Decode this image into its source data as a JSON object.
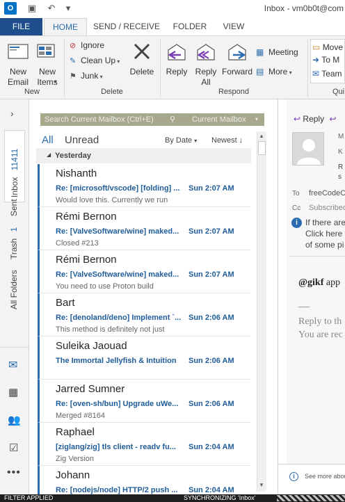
{
  "window": {
    "title": "Inbox - vm0b0t@com"
  },
  "ribbon_tabs": {
    "file": "FILE",
    "home": "HOME",
    "send_receive": "SEND / RECEIVE",
    "folder": "FOLDER",
    "view": "VIEW"
  },
  "ribbon": {
    "new_email": "New\nEmail",
    "new_email_l1": "New",
    "new_email_l2": "Email",
    "new_items_l1": "New",
    "new_items_l2": "Items",
    "group_new": "New",
    "ignore": "Ignore",
    "clean_up": "Clean Up",
    "junk": "Junk",
    "delete": "Delete",
    "group_delete": "Delete",
    "reply": "Reply",
    "reply_all_l1": "Reply",
    "reply_all_l2": "All",
    "forward": "Forward",
    "meeting": "Meeting",
    "more": "More",
    "group_respond": "Respond",
    "move_to": "Move",
    "to_manager": "To M",
    "team": "Team",
    "group_quick": "Qui"
  },
  "leftnav": {
    "inbox_label": "Inbox",
    "inbox_count": "11411",
    "sent_label": "Sent",
    "trash_label": "Trash",
    "trash_count": "1",
    "all_folders_label": "All Folders"
  },
  "list": {
    "search_placeholder": "Search Current Mailbox (Ctrl+E)",
    "search_scope": "Current Mailbox",
    "filter_all": "All",
    "filter_unread": "Unread",
    "sort_by": "By Date",
    "sort_order": "Newest",
    "group_header": "Yesterday",
    "messages": [
      {
        "sender": "Nishanth",
        "subject": "Re: [microsoft/vscode] [folding] ...",
        "time": "Sun 2:07 AM",
        "preview": "Would love this. Currently we run"
      },
      {
        "sender": "Rémi Bernon",
        "subject": "Re: [ValveSoftware/wine] maked...",
        "time": "Sun 2:07 AM",
        "preview": "Closed #213"
      },
      {
        "sender": "Rémi Bernon",
        "subject": "Re: [ValveSoftware/wine] maked...",
        "time": "Sun 2:07 AM",
        "preview": "You need to use Proton build"
      },
      {
        "sender": "Bart",
        "subject": "Re: [denoland/deno] Implement `...",
        "time": "Sun 2:06 AM",
        "preview": "This method is definitely not just"
      },
      {
        "sender": "Suleika Jaouad",
        "subject": "The Immortal Jellyfish & Intuition",
        "time": "Sun 2:06 AM",
        "preview": ""
      },
      {
        "sender": "Jarred Sumner",
        "subject": "Re: [oven-sh/bun] Upgrade uWe...",
        "time": "Sun 2:06 AM",
        "preview": "Merged #8164"
      },
      {
        "sender": "Raphael",
        "subject": "[ziglang/zig] tls client  - readv fu...",
        "time": "Sun 2:04 AM",
        "preview": "Zig Version"
      },
      {
        "sender": "Johann",
        "subject": "Re: [nodejs/node] HTTP/2 push ...",
        "time": "Sun 2:04 AM",
        "preview": ""
      }
    ]
  },
  "reading": {
    "reply": "Reply",
    "to_label": "To",
    "to_value": "freeCodeC",
    "cc_label": "Cc",
    "cc_value": "Subscribed",
    "info_line1": "If there are",
    "info_line2": "Click here t",
    "info_line3": "of some pi",
    "body_mention": "@gikf",
    "body_mention_rest": " app",
    "body_reply_l1": "Reply to th",
    "body_reply_l2": "You are rec",
    "footer_more": "See more abou",
    "header_letters": [
      "M",
      "K",
      "R",
      "s"
    ]
  },
  "statusbar": {
    "filter": "FILTER APPLIED",
    "sync": "SYNCHRONIZING 'Inbox'"
  },
  "colors": {
    "accent": "#2b6cb0",
    "file_tab": "#1e4e8c",
    "unread_bar": "#2b6cb0"
  }
}
